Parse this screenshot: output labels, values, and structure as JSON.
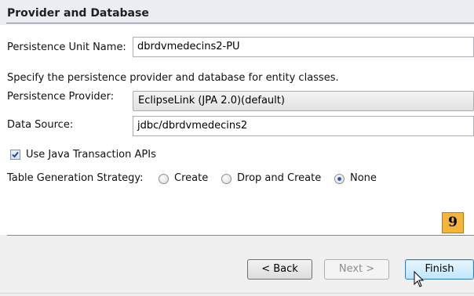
{
  "header": {
    "title": "Provider and Database"
  },
  "form": {
    "persistence_unit_label": "Persistence Unit Name:",
    "persistence_unit_value": "dbrdvmedecins2-PU",
    "description": "Specify the persistence provider and database for entity classes.",
    "provider_label": "Persistence Provider:",
    "provider_value": "EclipseLink (JPA 2.0)(default)",
    "datasource_label": "Data Source:",
    "datasource_value": "jdbc/dbrdvmedecins2",
    "jta_label": "Use Java Transaction APIs",
    "jta_checked": true,
    "strategy_label": "Table Generation Strategy:",
    "strategy_options": [
      "Create",
      "Drop and Create",
      "None"
    ],
    "strategy_selected": "None"
  },
  "annotation": {
    "step_badge": "9"
  },
  "buttons": {
    "back": "< Back",
    "next": "Next >",
    "finish": "Finish"
  },
  "icons": {
    "checkbox_check": "checkmark-icon",
    "cursor": "mouse-pointer-icon"
  }
}
